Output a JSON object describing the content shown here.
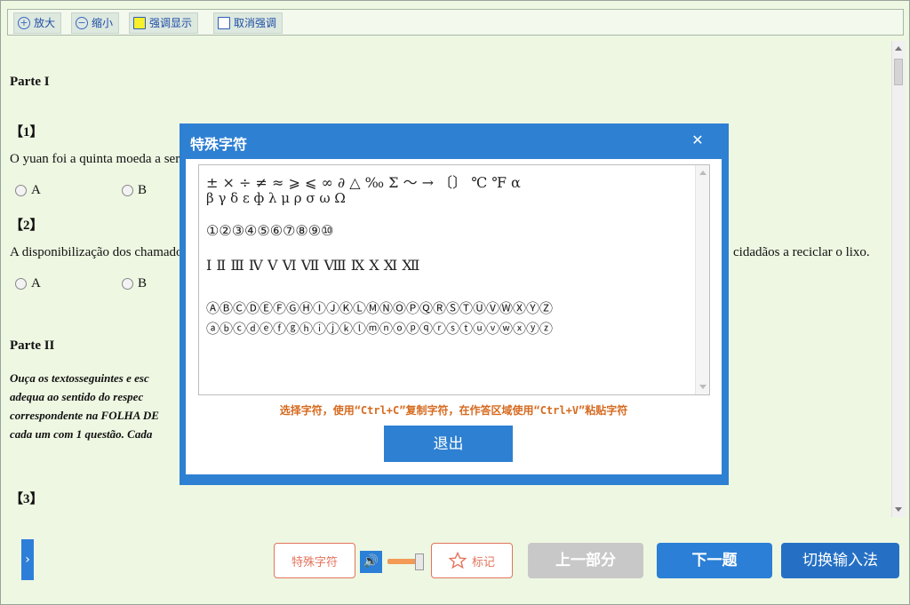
{
  "toolbar": {
    "zoom_in": "放大",
    "zoom_out": "缩小",
    "highlight": "强调显示",
    "unhighlight": "取消强调"
  },
  "content": {
    "part1_title": "Parte I",
    "q1_label": "【1】",
    "q1_text": "O yuan foi a quinta moeda a ser",
    "q1_opt_a": "A",
    "q1_opt_b": "B",
    "q2_label": "【2】",
    "q2_text_left": "A disponibilização dos chamado",
    "q2_text_right": "cidadãos a reciclar o lixo.",
    "q2_opt_a": "A",
    "q2_opt_b": "B",
    "part2_title": "Parte II",
    "instr_1": "Ouça  os  textosseguintes  e  esc",
    "instr_2": "adequa  ao  sentido  do  respec",
    "instr_3": "correspondente  na  FOLHA  DE",
    "instr_4": "cada um com 1 questão. Cada",
    "q3_label": "【3】"
  },
  "dialog": {
    "title": "特殊字符",
    "close": "✕",
    "line1": "±  ×  ÷  ≠  ≈  ⩾  ⩽  ∞  ∂  △  ‰  Σ  ～  →  〔〕  ℃  ℉  α",
    "line2": "β  γ  δ  ε  ф  λ  μ  ρ  σ  ω  Ω",
    "line3": "①②③④⑤⑥⑦⑧⑨⑩",
    "line4": "Ⅰ  Ⅱ  Ⅲ  Ⅳ  Ⅴ  Ⅵ  Ⅶ  Ⅷ  Ⅸ  Ⅹ  Ⅺ  Ⅻ",
    "line5": "ⒶⒷⒸⒹⒺⒻⒼⒽⒾⒿⓀⓁⓂⓃⓄⓅⓆⓇⓈⓉⓊⓋⓌⓍⓎⓏ",
    "line6": "ⓐⓑⓒⓓⓔⓕⓖⓗⓘⓙⓚⓛⓜⓝⓞⓟⓠⓡⓢⓣⓤⓥⓦⓧⓨⓩ",
    "hint": "选择字符，使用“Ctrl+C”复制字符，在作答区域使用“Ctrl+V”粘贴字符",
    "exit": "退出"
  },
  "bottom": {
    "side_tab": "›",
    "special_chars": "特殊字符",
    "volume_icon": "speaker-icon",
    "mark": "标记",
    "prev_section": "上一部分",
    "next_question": "下一题",
    "switch_ime": "切换输入法"
  },
  "colors": {
    "background": "#eef7e2",
    "accent_blue": "#2e80d2",
    "orange": "#e3745c",
    "disabled": "#c8c8c8"
  }
}
